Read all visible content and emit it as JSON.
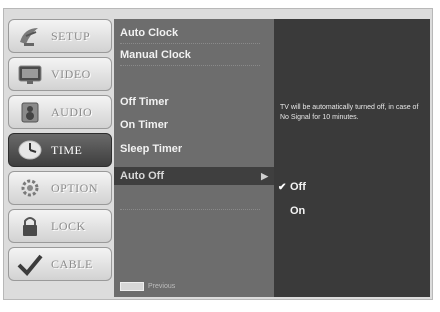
{
  "sidebar": {
    "items": [
      {
        "label": "SETUP",
        "icon": "satellite-dish-icon"
      },
      {
        "label": "VIDEO",
        "icon": "tv-screen-icon"
      },
      {
        "label": "AUDIO",
        "icon": "speaker-icon"
      },
      {
        "label": "TIME",
        "icon": "clock-icon"
      },
      {
        "label": "OPTION",
        "icon": "gear-icon"
      },
      {
        "label": "LOCK",
        "icon": "padlock-icon"
      },
      {
        "label": "CABLE",
        "icon": "checkmark-icon"
      }
    ],
    "active_index": 3
  },
  "menu": {
    "items": [
      {
        "label": "Auto Clock"
      },
      {
        "label": "Manual Clock"
      },
      {
        "label": "Off Timer"
      },
      {
        "label": "On Timer"
      },
      {
        "label": "Sleep Timer"
      },
      {
        "label": "Auto Off"
      }
    ],
    "selected_index": 5,
    "arrow": "▶",
    "hint_text": "Previous"
  },
  "submenu": {
    "description": "TV will be automatically turned off, in case of No Signal for 10 minutes.",
    "options": [
      {
        "label": "Off",
        "checked": true
      },
      {
        "label": "On",
        "checked": false
      }
    ],
    "check_glyph": "✔"
  },
  "colors": {
    "menu_bg": "#6d6d6d",
    "submenu_bg": "#3a3a3a",
    "active_tab": "#4a4a4a"
  }
}
